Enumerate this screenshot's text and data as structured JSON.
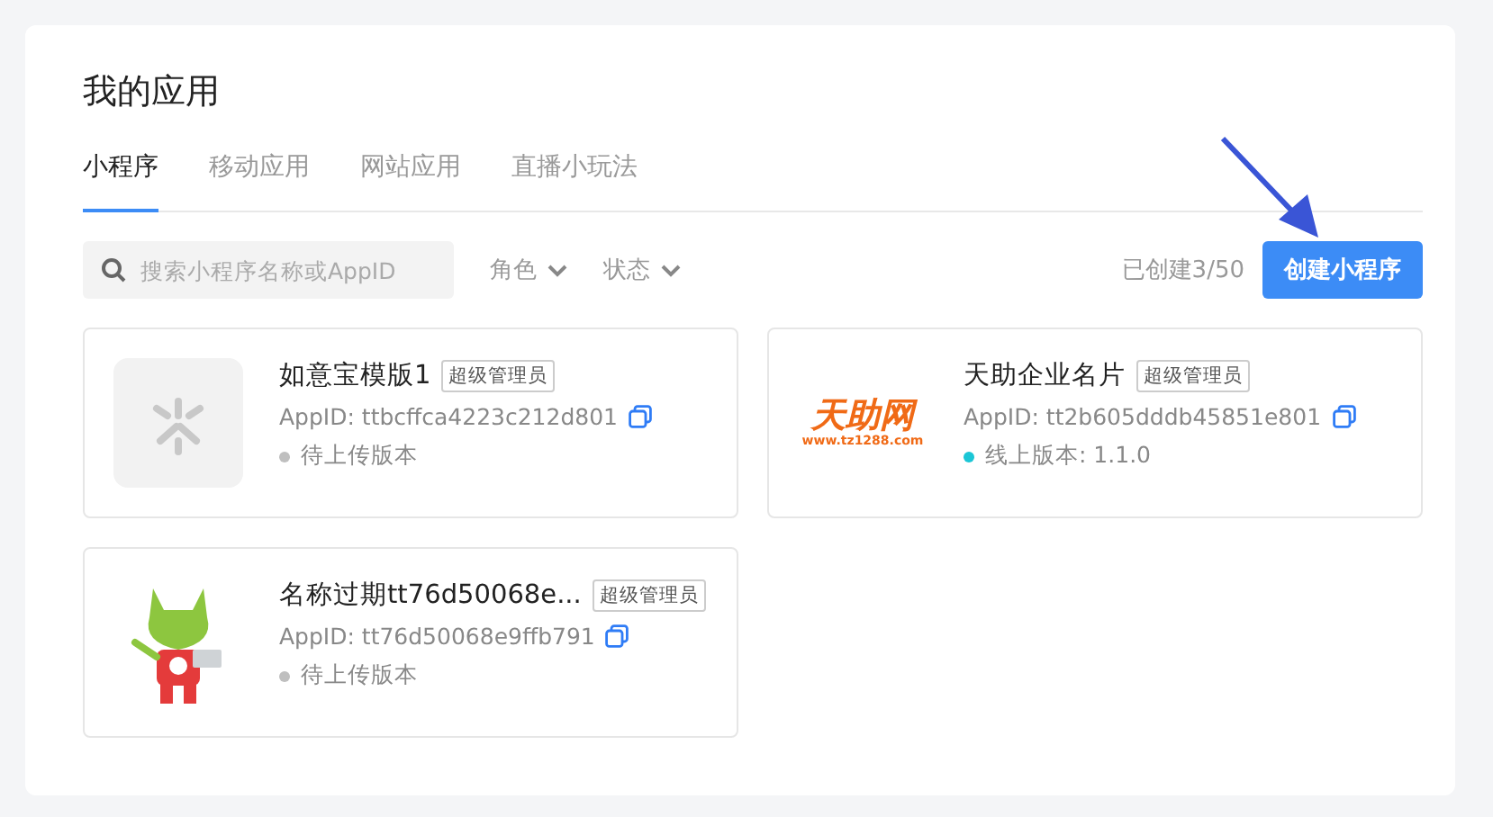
{
  "title": "我的应用",
  "tabs": [
    {
      "label": "小程序",
      "selected": true
    },
    {
      "label": "移动应用",
      "selected": false
    },
    {
      "label": "网站应用",
      "selected": false
    },
    {
      "label": "直播小玩法",
      "selected": false
    }
  ],
  "search": {
    "placeholder": "搜索小程序名称或AppID"
  },
  "filters": [
    "角色",
    "状态"
  ],
  "created_count": "已创建3/50",
  "create_button": "创建小程序",
  "apps": [
    {
      "kind": "default",
      "name": "如意宝模版1",
      "role": "超级管理员",
      "appid": "AppID: ttbcffca4223c212d801",
      "status": "待上传版本",
      "color": "#bfbfbf"
    },
    {
      "kind": "logo",
      "logo_title": "天助网",
      "logo_url": "www.tz1288.com",
      "name": "天助企业名片",
      "role": "超级管理员",
      "appid": "AppID: tt2b605dddb45851e801",
      "status": "线上版本: 1.1.0",
      "color": "#1bc6d6"
    },
    {
      "kind": "mascot",
      "name": "名称过期tt76d50068e...",
      "role": "超级管理员",
      "appid": "AppID: tt76d50068e9ffb791",
      "status": "待上传版本",
      "color": "#bfbfbf"
    }
  ]
}
